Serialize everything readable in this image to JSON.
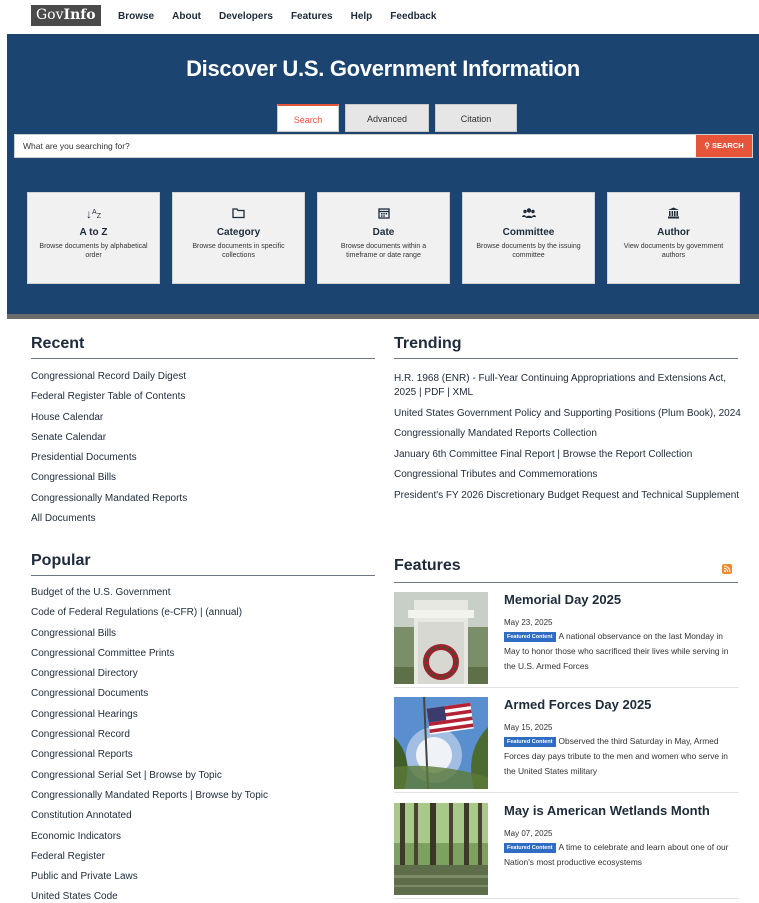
{
  "logo": {
    "prefix": "Gov",
    "bold": "Info"
  },
  "nav": [
    "Browse",
    "About",
    "Developers",
    "Features",
    "Help",
    "Feedback"
  ],
  "hero": {
    "title": "Discover U.S. Government Information",
    "tabs": [
      "Search",
      "Advanced",
      "Citation"
    ],
    "search_placeholder": "What are you searching for?",
    "search_button": "SEARCH"
  },
  "cards": [
    {
      "icon": "sort-az-icon",
      "glyph": "↓₂",
      "title": "A to Z",
      "desc": "Browse documents by alphabetical order"
    },
    {
      "icon": "folder-icon",
      "glyph": "🗁",
      "title": "Category",
      "desc": "Browse documents in specific collections"
    },
    {
      "icon": "calendar-icon",
      "glyph": "▦",
      "title": "Date",
      "desc": "Browse documents within a timeframe or date range"
    },
    {
      "icon": "users-icon",
      "glyph": "👥",
      "title": "Committee",
      "desc": "Browse documents by the issuing committee"
    },
    {
      "icon": "institution-icon",
      "glyph": "🏛",
      "title": "Author",
      "desc": "View documents by government authors"
    }
  ],
  "recent": {
    "title": "Recent",
    "items": [
      "Congressional Record Daily Digest",
      "Federal Register Table of Contents",
      "House Calendar",
      "Senate Calendar",
      "Presidential Documents",
      "Congressional Bills",
      "Congressionally Mandated Reports",
      "All Documents"
    ]
  },
  "popular": {
    "title": "Popular",
    "items": [
      "Budget of the U.S. Government",
      "Code of Federal Regulations (e-CFR) | (annual)",
      "Congressional Bills",
      "Congressional Committee Prints",
      "Congressional Directory",
      "Congressional Documents",
      "Congressional Hearings",
      "Congressional Record",
      "Congressional Reports",
      "Congressional Serial Set | Browse by Topic",
      "Congressionally Mandated Reports | Browse by Topic",
      "Constitution Annotated",
      "Economic Indicators",
      "Federal Register",
      "Public and Private Laws",
      "United States Code"
    ]
  },
  "trending": {
    "title": "Trending",
    "items": [
      "H.R. 1968 (ENR) - Full-Year Continuing Appropriations and Extensions Act, 2025 | PDF | XML",
      "United States Government Policy and Supporting Positions (Plum Book), 2024",
      "Congressionally Mandated Reports Collection",
      "January 6th Committee Final Report | Browse the Report Collection",
      "Congressional Tributes and Commemorations",
      "President's FY 2026 Discretionary Budget Request and Technical Supplement"
    ]
  },
  "features": {
    "title": "Features",
    "badge": "Featured Content",
    "items": [
      {
        "title": "Memorial Day 2025",
        "date": "May 23, 2025",
        "desc": "A national observance on the last Monday in May to honor those who sacrificed their lives while serving in the U.S. Armed Forces"
      },
      {
        "title": "Armed Forces Day 2025",
        "date": "May 15, 2025",
        "desc": "Observed the third Saturday in May, Armed Forces day pays tribute to the men and women who serve in the United States military"
      },
      {
        "title": "May is American Wetlands Month",
        "date": "May 07, 2025",
        "desc": "A time to celebrate and learn about one of our Nation's most productive ecosystems"
      }
    ]
  },
  "colors": {
    "hero_bg": "#1b4470",
    "accent": "#e6553a",
    "badge": "#2f6cc4",
    "rss": "#f0892b"
  }
}
